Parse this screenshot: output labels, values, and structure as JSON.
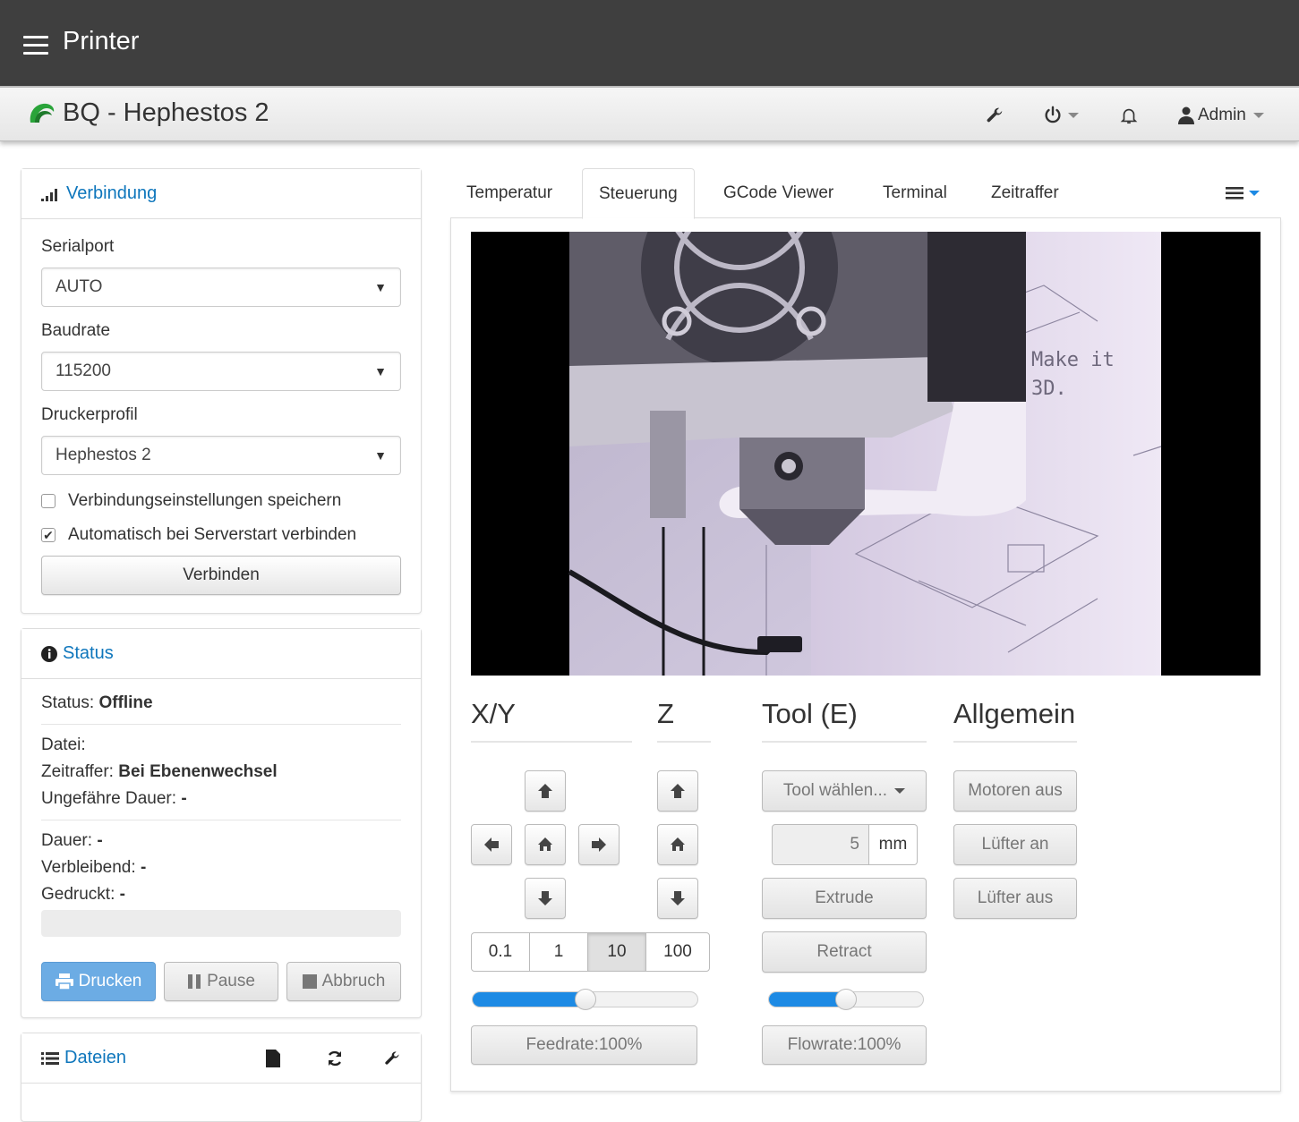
{
  "topbar": {
    "title": "Printer"
  },
  "navbar": {
    "brand": "BQ - Hephestos 2",
    "user": "Admin"
  },
  "connection": {
    "title": "Verbindung",
    "serialport_label": "Serialport",
    "serialport_value": "AUTO",
    "baudrate_label": "Baudrate",
    "baudrate_value": "115200",
    "profile_label": "Druckerprofil",
    "profile_value": "Hephestos 2",
    "save_settings_label": "Verbindungseinstellungen speichern",
    "save_settings_checked": false,
    "autoconnect_label": "Automatisch bei Serverstart verbinden",
    "autoconnect_checked": true,
    "connect_button": "Verbinden"
  },
  "status": {
    "title": "Status",
    "state_label": "Status:",
    "state_value": "Offline",
    "file_label": "Datei:",
    "file_value": "",
    "timelapse_label": "Zeitraffer:",
    "timelapse_value": "Bei Ebenenwechsel",
    "approx_label": "Ungefähre Dauer:",
    "approx_value": "-",
    "duration_label": "Dauer:",
    "duration_value": "-",
    "remaining_label": "Verbleibend:",
    "remaining_value": "-",
    "printed_label": "Gedruckt:",
    "printed_value": "-",
    "progress": 0,
    "print_button": "Drucken",
    "pause_button": "Pause",
    "cancel_button": "Abbruch"
  },
  "files": {
    "title": "Dateien"
  },
  "tabs": [
    "Temperatur",
    "Steuerung",
    "GCode Viewer",
    "Terminal",
    "Zeitraffer"
  ],
  "active_tab": "Steuerung",
  "webcam": {
    "overlay_text_1": "Make it",
    "overlay_text_2": "3D."
  },
  "control": {
    "xy_title": "X/Y",
    "z_title": "Z",
    "tool_title": "Tool (E)",
    "general_title": "Allgemein",
    "step_sizes": [
      "0.1",
      "1",
      "10",
      "100"
    ],
    "active_step": "10",
    "feedrate_label": "Feedrate:100%",
    "feedrate_value": 100,
    "flowrate_label": "Flowrate:100%",
    "flowrate_value": 100,
    "tool_select": "Tool wählen...",
    "extrude_amount": "5",
    "extrude_unit": "mm",
    "extrude_button": "Extrude",
    "retract_button": "Retract",
    "motors_off": "Motoren aus",
    "fan_on": "Lüfter an",
    "fan_off": "Lüfter aus"
  },
  "colors": {
    "topbar": "#3f3f3f",
    "link": "#0e76bc",
    "primary": "#6cace4",
    "slider_fill": "#1d8ae4",
    "brand_logo": "#2aa43a"
  }
}
